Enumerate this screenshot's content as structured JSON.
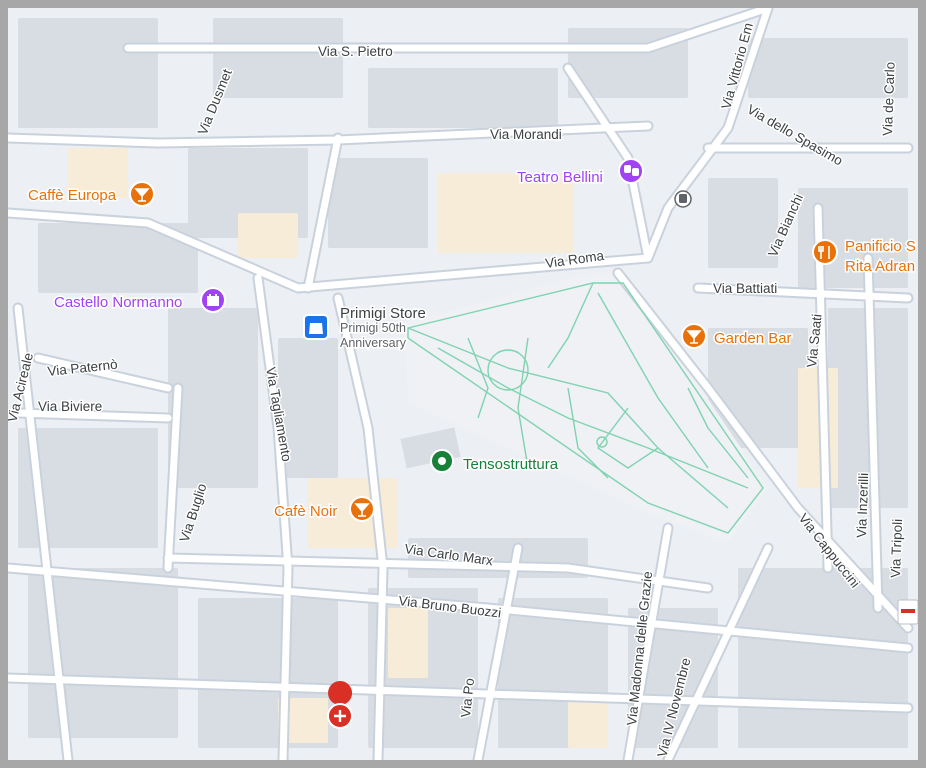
{
  "map": {
    "colors": {
      "background": "#eceff3",
      "road": "#ffffff",
      "road_casing": "#c9d2dc",
      "building": "#d8dde3",
      "park_path": "#7fd3b0",
      "poi_food": "#e8710a",
      "poi_culture": "#a142f4",
      "poi_place": "#188038",
      "poi_shop": "#1a73e8",
      "poi_health": "#d93025"
    },
    "streets": {
      "via_s_pietro": "Via S. Pietro",
      "via_dusmet": "Via Dusmet",
      "via_morandi": "Via Morandi",
      "via_vittorio": "Via Vittorio Em",
      "via_de_carlo": "Via de Carlo",
      "via_dello_spasimo": "Via dello Spasimo",
      "via_bianchi": "Via Bianchi",
      "via_roma": "Via Roma",
      "via_battiati": "Via Battiati",
      "via_saati": "Via Saati",
      "via_acireale": "Via Acireale",
      "via_paterno": "Via Paternò",
      "via_biviere": "Via Biviere",
      "via_tagliamento": "Via Tagliamento",
      "via_buglio": "Via Buglio",
      "via_inzerilli": "Via Inzerilli",
      "via_tripoli": "Via Tripoli",
      "via_cappuccini": "Via Cappuccini",
      "via_carlo_marx": "Via Carlo Marx",
      "via_bruno_buozzi": "Via Bruno Buozzi",
      "via_madonna": "Via Madonna delle Grazie",
      "via_po": "Via Po",
      "via_iv_novembre": "Via IV Novembre"
    },
    "pois": {
      "caffe_europa": {
        "name": "Caffè Europa",
        "icon": "cocktail-icon"
      },
      "teatro_bellini": {
        "name": "Teatro Bellini",
        "icon": "theater-masks-icon"
      },
      "castello_normanno": {
        "name": "Castello Normanno",
        "icon": "castle-icon"
      },
      "panificio": {
        "name_line1": "Panificio S",
        "name_line2": "Rita Adran",
        "icon": "fork-knife-icon"
      },
      "garden_bar": {
        "name": "Garden Bar",
        "icon": "cocktail-icon"
      },
      "primigi_store": {
        "name": "Primigi Store",
        "sub_line1": "Primigi 50th",
        "sub_line2": "Anniversary",
        "icon": "shopping-bag-icon"
      },
      "tensostruttura": {
        "name": "Tensostruttura",
        "icon": "place-pin-icon"
      },
      "cafe_noir": {
        "name": "Cafè Noir",
        "icon": "cocktail-icon"
      },
      "hospital": {
        "icon": "hospital-cross-icon"
      },
      "bus_stop": {
        "icon": "bus-icon"
      }
    }
  }
}
